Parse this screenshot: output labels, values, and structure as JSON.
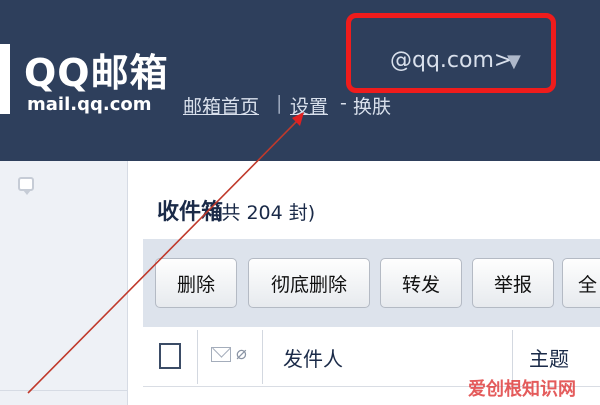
{
  "header": {
    "logo_title": "QQ邮箱",
    "logo_subtitle": "mail.qq.com",
    "nav": {
      "home": "邮箱首页",
      "separator": "|",
      "settings": "设置",
      "dash": "-",
      "skin": "换肤"
    },
    "account": "@qq.com>",
    "account_arrow": "▼"
  },
  "inbox": {
    "title": "收件箱",
    "count": "(共 204 封)"
  },
  "toolbar": {
    "delete": "删除",
    "delete_permanently": "彻底删除",
    "forward": "转发",
    "report": "举报",
    "all": "全"
  },
  "list_header": {
    "sender": "发件人",
    "subject": "主题"
  },
  "watermark": "爱创根知识网",
  "colors": {
    "header_bg": "#2e3f5c",
    "highlight": "#ef1c1c",
    "annotation_arrow": "#c0392b"
  },
  "icons": [
    "chat-icon",
    "mail-icon",
    "attachment-icon",
    "dropdown-arrow-icon"
  ]
}
